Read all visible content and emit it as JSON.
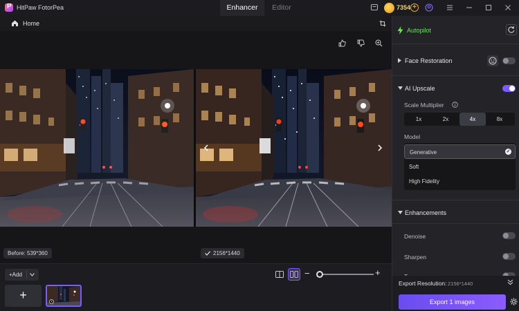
{
  "titlebar": {
    "app_title": "HitPaw FotorPea",
    "tabs": [
      {
        "label": "Enhancer",
        "active": true
      },
      {
        "label": "Editor",
        "active": false
      }
    ],
    "coins": "7354",
    "coin_plus": "+"
  },
  "main": {
    "home_label": "Home",
    "before_badge": "Before: 539*360",
    "after_badge": "2156*1440"
  },
  "bottom": {
    "add_label": "Add",
    "plus": "+"
  },
  "panel": {
    "autopilot": "Autopilot",
    "face_restoration": {
      "title": "Face Restoration",
      "enabled": false
    },
    "ai_upscale": {
      "title": "AI Upscale",
      "enabled": true,
      "scale_label": "Scale Multiplier",
      "scale_options": [
        "1x",
        "2x",
        "4x",
        "8x"
      ],
      "scale_selected": "4x",
      "model_label": "Model",
      "model_options": [
        "Generative",
        "Soft",
        "High Fidelity"
      ],
      "model_selected": "Generative"
    },
    "enhancements": {
      "title": "Enhancements",
      "items": [
        {
          "label": "Denoise",
          "enabled": false
        },
        {
          "label": "Sharpen",
          "enabled": false
        },
        {
          "label": "T",
          "enabled": false
        }
      ]
    },
    "export_resolution_label": "Export Resolution:",
    "export_resolution_value": "2156*1440",
    "export_button": "Export 1 images"
  },
  "colors": {
    "accent": "#7b5cff",
    "autopilot_green": "#6fe05c",
    "coin": "#e8a81c"
  }
}
